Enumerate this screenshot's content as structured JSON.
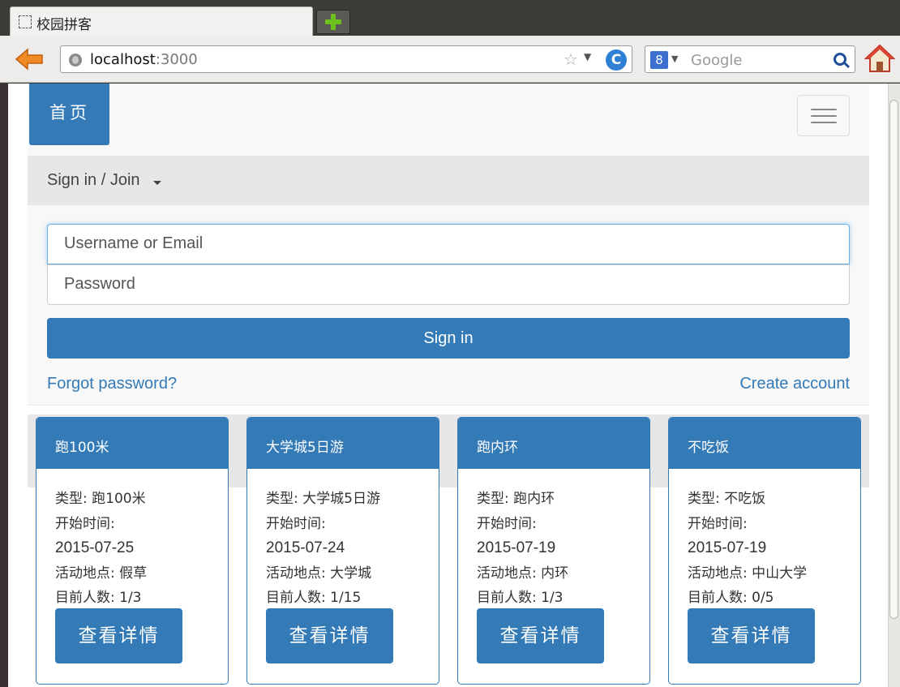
{
  "browser": {
    "tab_title": "校园拼客",
    "url_host": "localhost",
    "url_port": ":3000",
    "search_engine": "8",
    "search_placeholder": "Google"
  },
  "nav": {
    "home_label": "首页"
  },
  "auth": {
    "toggle_label": "Sign in / Join",
    "username_placeholder": "Username or Email",
    "password_placeholder": "Password",
    "signin_label": "Sign in",
    "forgot_label": "Forgot password?",
    "create_label": "Create account"
  },
  "cards": [
    {
      "title": "跑100米",
      "type": "类型: 跑100米",
      "start_label": "开始时间:",
      "start_date": "2015-07-25",
      "location": "活动地点: 假草",
      "count": "目前人数: 1/3",
      "button": "查看详情"
    },
    {
      "title": "大学城5日游",
      "type": "类型: 大学城5日游",
      "start_label": "开始时间:",
      "start_date": "2015-07-24",
      "location": "活动地点: 大学城",
      "count": "目前人数: 1/15",
      "button": "查看详情"
    },
    {
      "title": "跑内环",
      "type": "类型: 跑内环",
      "start_label": "开始时间:",
      "start_date": "2015-07-19",
      "location": "活动地点: 内环",
      "count": "目前人数: 1/3",
      "button": "查看详情"
    },
    {
      "title": "不吃饭",
      "type": "类型: 不吃饭",
      "start_label": "开始时间:",
      "start_date": "2015-07-19",
      "location": "活动地点: 中山大学",
      "count": "目前人数: 0/5",
      "button": "查看详情"
    }
  ],
  "colors": {
    "primary": "#337ab7",
    "navbar_bg": "#f8f8f8",
    "strip_bg": "#e7e7e7"
  }
}
